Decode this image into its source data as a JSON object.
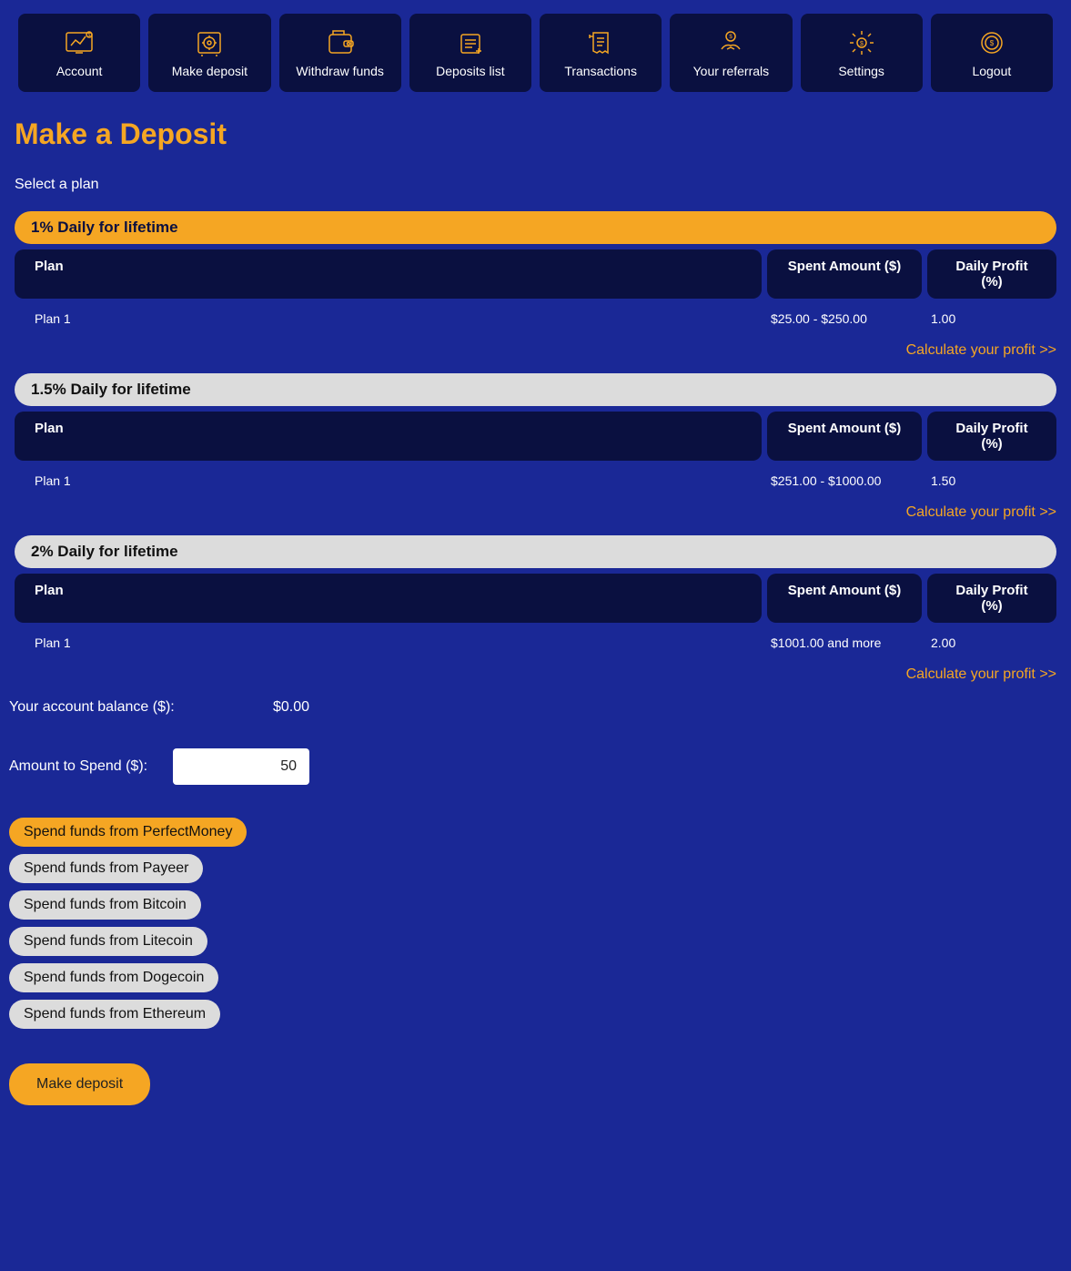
{
  "nav": [
    {
      "label": "Account"
    },
    {
      "label": "Make deposit"
    },
    {
      "label": "Withdraw funds"
    },
    {
      "label": "Deposits list"
    },
    {
      "label": "Transactions"
    },
    {
      "label": "Your referrals"
    },
    {
      "label": "Settings"
    },
    {
      "label": "Logout"
    }
  ],
  "page_title": "Make a Deposit",
  "select_plan_label": "Select a plan",
  "headers": {
    "plan": "Plan",
    "spent": "Spent Amount ($)",
    "profit": "Daily Profit (%)"
  },
  "plans": [
    {
      "title": "1% Daily for lifetime",
      "active": true,
      "row": {
        "name": "Plan 1",
        "spent": "$25.00 - $250.00",
        "profit": "1.00"
      }
    },
    {
      "title": "1.5% Daily for lifetime",
      "active": false,
      "row": {
        "name": "Plan 1",
        "spent": "$251.00 - $1000.00",
        "profit": "1.50"
      }
    },
    {
      "title": "2% Daily for lifetime",
      "active": false,
      "row": {
        "name": "Plan 1",
        "spent": "$1001.00 and more",
        "profit": "2.00"
      }
    }
  ],
  "calc_link": "Calculate your profit >>",
  "balance_label": "Your account balance ($):",
  "balance_value": "$0.00",
  "amount_label": "Amount to Spend ($):",
  "amount_value": "50",
  "fund_sources": [
    {
      "label": "Spend funds from PerfectMoney",
      "active": true
    },
    {
      "label": "Spend funds from Payeer",
      "active": false
    },
    {
      "label": "Spend funds from Bitcoin",
      "active": false
    },
    {
      "label": "Spend funds from Litecoin",
      "active": false
    },
    {
      "label": "Spend funds from Dogecoin",
      "active": false
    },
    {
      "label": "Spend funds from Ethereum",
      "active": false
    }
  ],
  "make_deposit_button": "Make deposit"
}
